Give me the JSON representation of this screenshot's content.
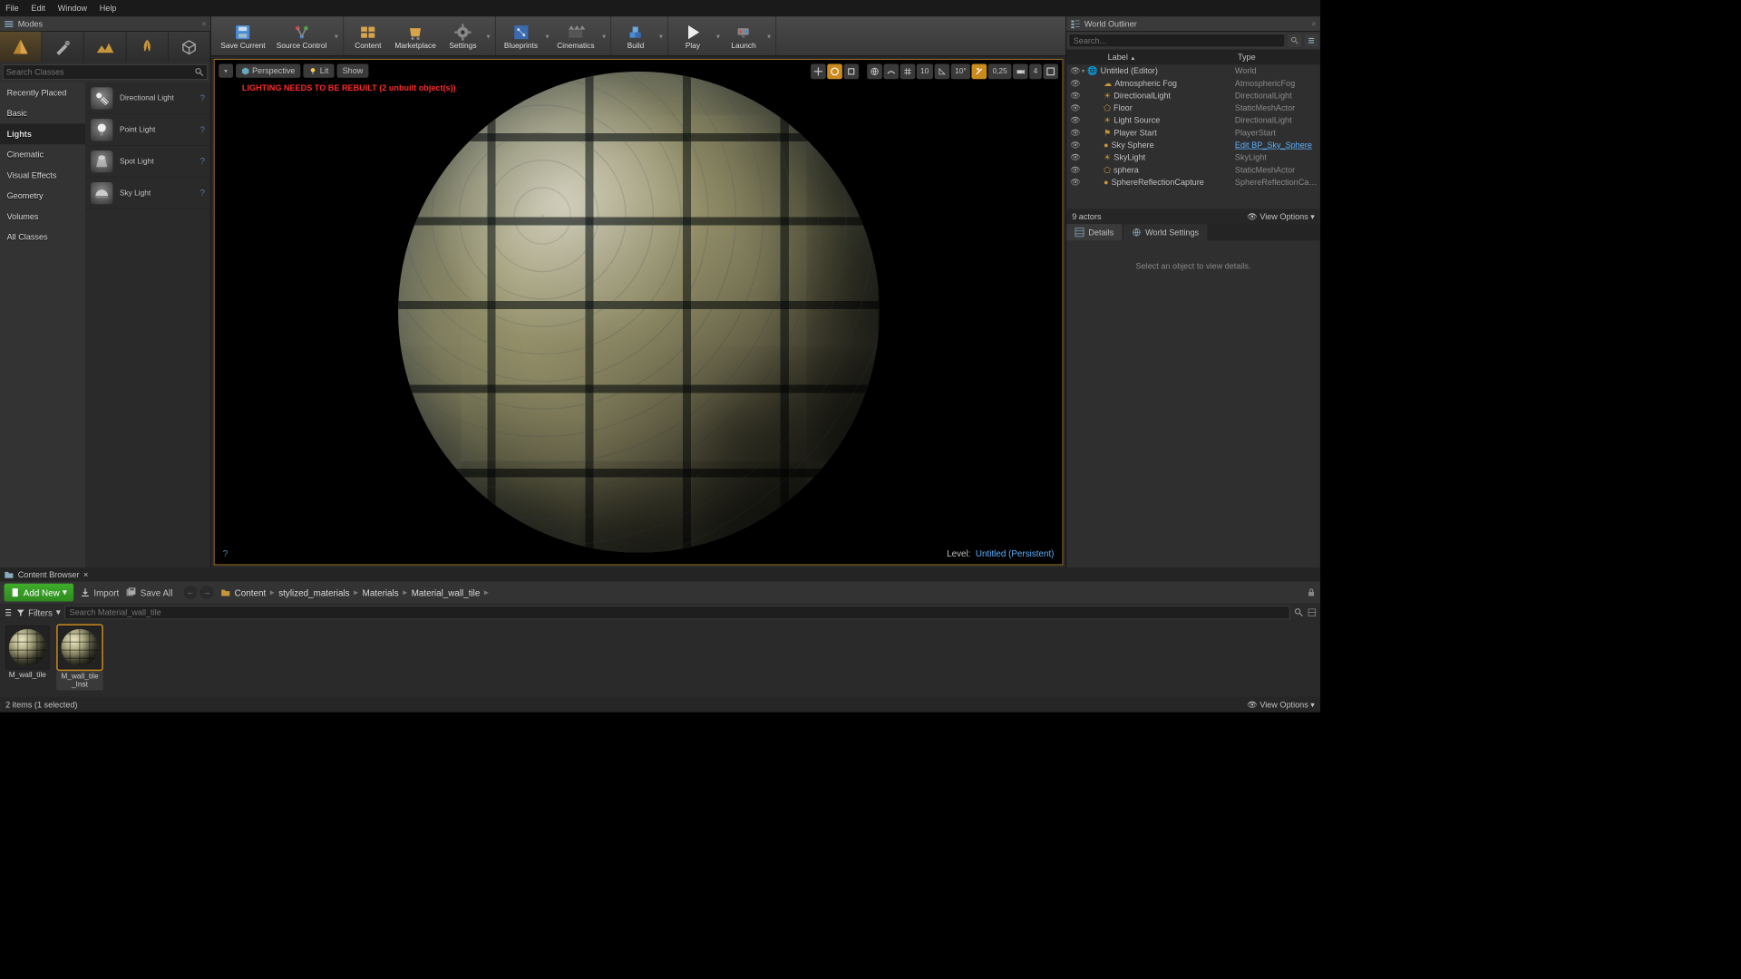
{
  "menu": {
    "items": [
      "File",
      "Edit",
      "Window",
      "Help"
    ]
  },
  "modes": {
    "tab_title": "Modes",
    "search_placeholder": "Search Classes",
    "categories": [
      "Recently Placed",
      "Basic",
      "Lights",
      "Cinematic",
      "Visual Effects",
      "Geometry",
      "Volumes",
      "All Classes"
    ],
    "selected_category": "Lights",
    "lights": [
      "Directional Light",
      "Point Light",
      "Spot Light",
      "Sky Light"
    ]
  },
  "toolbar": {
    "save_current": "Save Current",
    "source_control": "Source Control",
    "content": "Content",
    "marketplace": "Marketplace",
    "settings": "Settings",
    "blueprints": "Blueprints",
    "cinematics": "Cinematics",
    "build": "Build",
    "play": "Play",
    "launch": "Launch"
  },
  "viewport": {
    "perspective": "Perspective",
    "lit": "Lit",
    "show": "Show",
    "warning": "LIGHTING NEEDS TO BE REBUILT (2 unbuilt object(s))",
    "snap_angle": "10°",
    "snap_grid": "10",
    "snap_scale": "0,25",
    "cam_speed": "4",
    "level_label": "Level:",
    "level_name": "Untitled (Persistent)"
  },
  "outliner": {
    "tab_title": "World Outliner",
    "search_placeholder": "Search...",
    "col_label": "Label",
    "col_type": "Type",
    "root": {
      "name": "Untitled (Editor)",
      "type": "World"
    },
    "rows": [
      {
        "name": "Atmospheric Fog",
        "type": "AtmosphericFog",
        "icon": "cloud"
      },
      {
        "name": "DirectionalLight",
        "type": "DirectionalLight",
        "icon": "sun"
      },
      {
        "name": "Floor",
        "type": "StaticMeshActor",
        "icon": "mesh"
      },
      {
        "name": "Light Source",
        "type": "DirectionalLight",
        "icon": "sun"
      },
      {
        "name": "Player Start",
        "type": "PlayerStart",
        "icon": "flag"
      },
      {
        "name": "Sky Sphere",
        "type": "Edit BP_Sky_Sphere",
        "icon": "sphere",
        "link": true
      },
      {
        "name": "SkyLight",
        "type": "SkyLight",
        "icon": "sun"
      },
      {
        "name": "sphera",
        "type": "StaticMeshActor",
        "icon": "mesh"
      },
      {
        "name": "SphereReflectionCapture",
        "type": "SphereReflectionCapture",
        "icon": "sphere"
      }
    ],
    "count_label": "9 actors",
    "view_options": "View Options"
  },
  "details": {
    "tab_details": "Details",
    "tab_world": "World Settings",
    "empty": "Select an object to view details."
  },
  "content_browser": {
    "tab_title": "Content Browser",
    "add_new": "Add New",
    "import": "Import",
    "save_all": "Save All",
    "path_root": "Content",
    "path": [
      "stylized_materials",
      "Materials",
      "Material_wall_tile"
    ],
    "filters": "Filters",
    "search_placeholder": "Search Material_wall_tile",
    "assets": [
      {
        "name": "M_wall_tile",
        "selected": false
      },
      {
        "name": "M_wall_tile_Inst",
        "selected": true
      }
    ],
    "status": "2 items (1 selected)",
    "view_options": "View Options"
  }
}
